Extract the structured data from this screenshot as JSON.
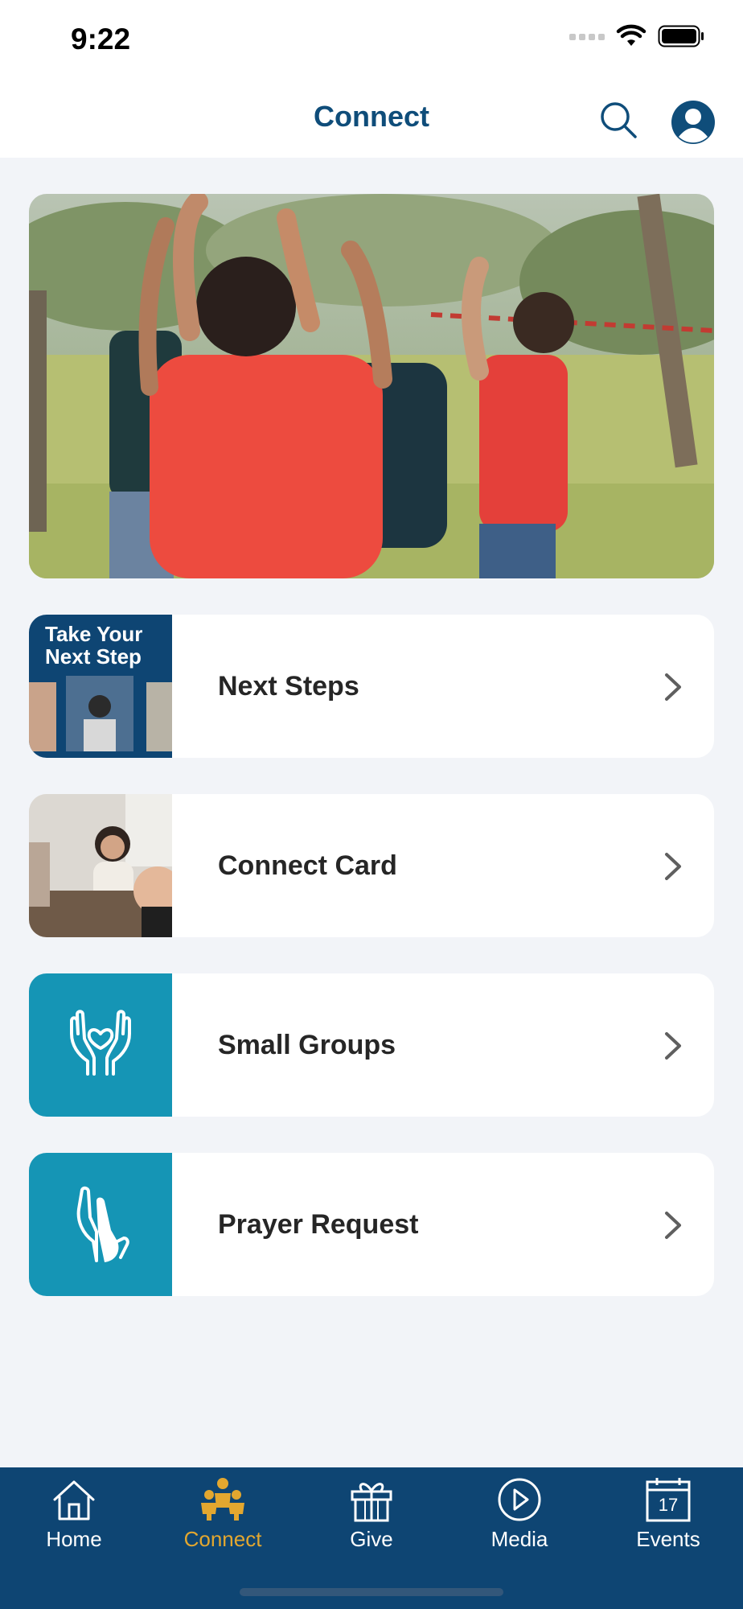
{
  "status_bar": {
    "time": "9:22"
  },
  "header": {
    "title": "Connect"
  },
  "menu": [
    {
      "label": "Next Steps",
      "thumb_text": "Take Your Next Step"
    },
    {
      "label": "Connect Card"
    },
    {
      "label": "Small Groups",
      "icon": "hands-heart-icon"
    },
    {
      "label": "Prayer Request",
      "icon": "praying-hands-icon"
    }
  ],
  "tabs": [
    {
      "label": "Home",
      "icon": "house-icon"
    },
    {
      "label": "Connect",
      "icon": "people-icon",
      "active": true
    },
    {
      "label": "Give",
      "icon": "gift-icon"
    },
    {
      "label": "Media",
      "icon": "play-circle-icon"
    },
    {
      "label": "Events",
      "icon": "calendar-icon",
      "date": "17"
    }
  ],
  "colors": {
    "brand_navy": "#0e4573",
    "accent_gold": "#e3a72f",
    "tile_teal": "#1595b5",
    "title_blue": "#0f4d7a"
  }
}
